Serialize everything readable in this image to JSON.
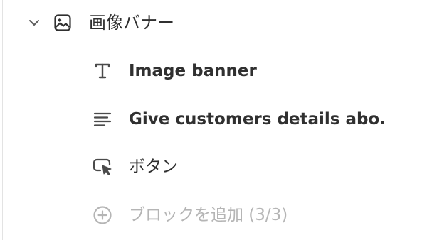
{
  "section": {
    "title": "画像バナー",
    "chevron_icon": "chevron-down-icon",
    "type_icon": "image-icon"
  },
  "blocks": [
    {
      "label": "Image banner",
      "icon": "text-icon"
    },
    {
      "label": "Give customers details abo...",
      "icon": "align-left-icon"
    },
    {
      "label": "ボタン",
      "icon": "button-cursor-icon"
    }
  ],
  "add_block": {
    "label": "ブロックを追加 (3/3)",
    "icon": "plus-circle-icon",
    "disabled": true
  },
  "colors": {
    "text": "#303030",
    "muted": "#b5b5b5",
    "icon": "#4a4a4a",
    "divider": "#e3e3e3"
  }
}
